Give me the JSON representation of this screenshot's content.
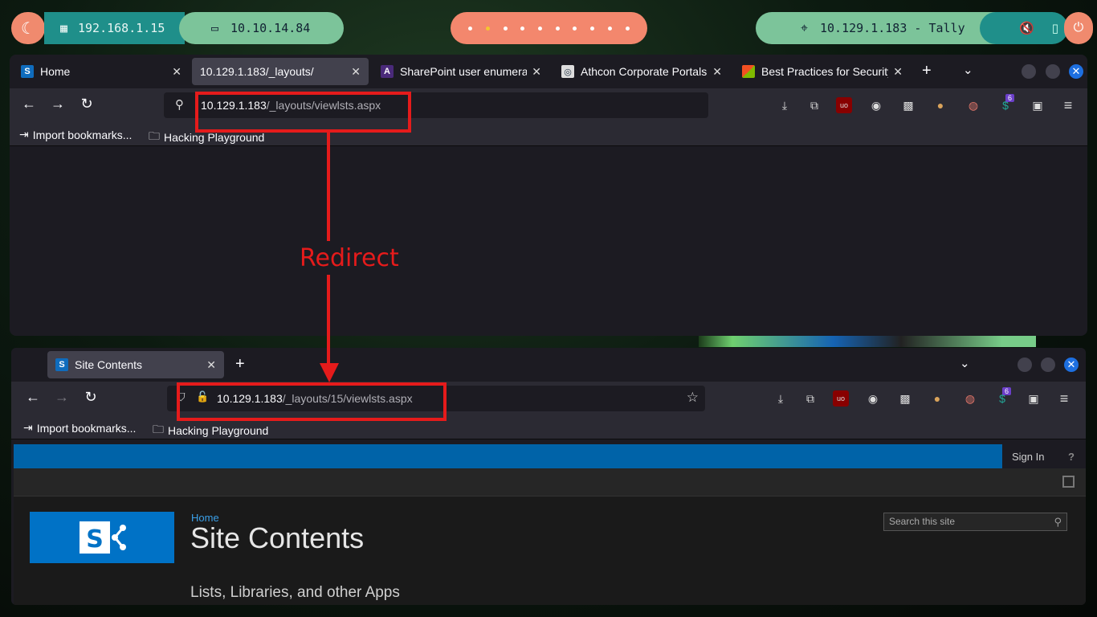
{
  "topbar": {
    "ip_local": "192.168.1.15",
    "ip_vpn": "10.10.14.84",
    "target": "10.129.1.183 - Tally"
  },
  "window1": {
    "tabs": [
      {
        "label": "Home",
        "favicon": "sharepoint-icon"
      },
      {
        "label": "10.129.1.183/_layouts/",
        "favicon": "none"
      },
      {
        "label": "SharePoint user enumerati",
        "favicon": "ahref-icon"
      },
      {
        "label": "Athcon Corporate Portals -",
        "favicon": "athcon-icon"
      },
      {
        "label": "Best Practices for Security",
        "favicon": "microsoft-icon"
      }
    ],
    "url_host": "10.129.1.183",
    "url_path": "/_layouts/viewlsts.aspx",
    "bookmarks": [
      "Import bookmarks...",
      "Hacking Playground"
    ],
    "ext_badge": "6"
  },
  "annotation": {
    "label": "Redirect",
    "color": "#e51b1b"
  },
  "window2": {
    "tabs": [
      {
        "label": "Site Contents",
        "favicon": "sharepoint-icon"
      }
    ],
    "url_host": "10.129.1.183",
    "url_path": "/_layouts/15/viewlsts.aspx",
    "bookmarks": [
      "Import bookmarks...",
      "Hacking Playground"
    ],
    "ext_badge": "6"
  },
  "sharepoint": {
    "sign_in": "Sign In",
    "help": "?",
    "breadcrumb": "Home",
    "title": "Site Contents",
    "search_placeholder": "Search this site",
    "subtitle": "Lists, Libraries, and other Apps",
    "brand_color": "#0063a8"
  }
}
